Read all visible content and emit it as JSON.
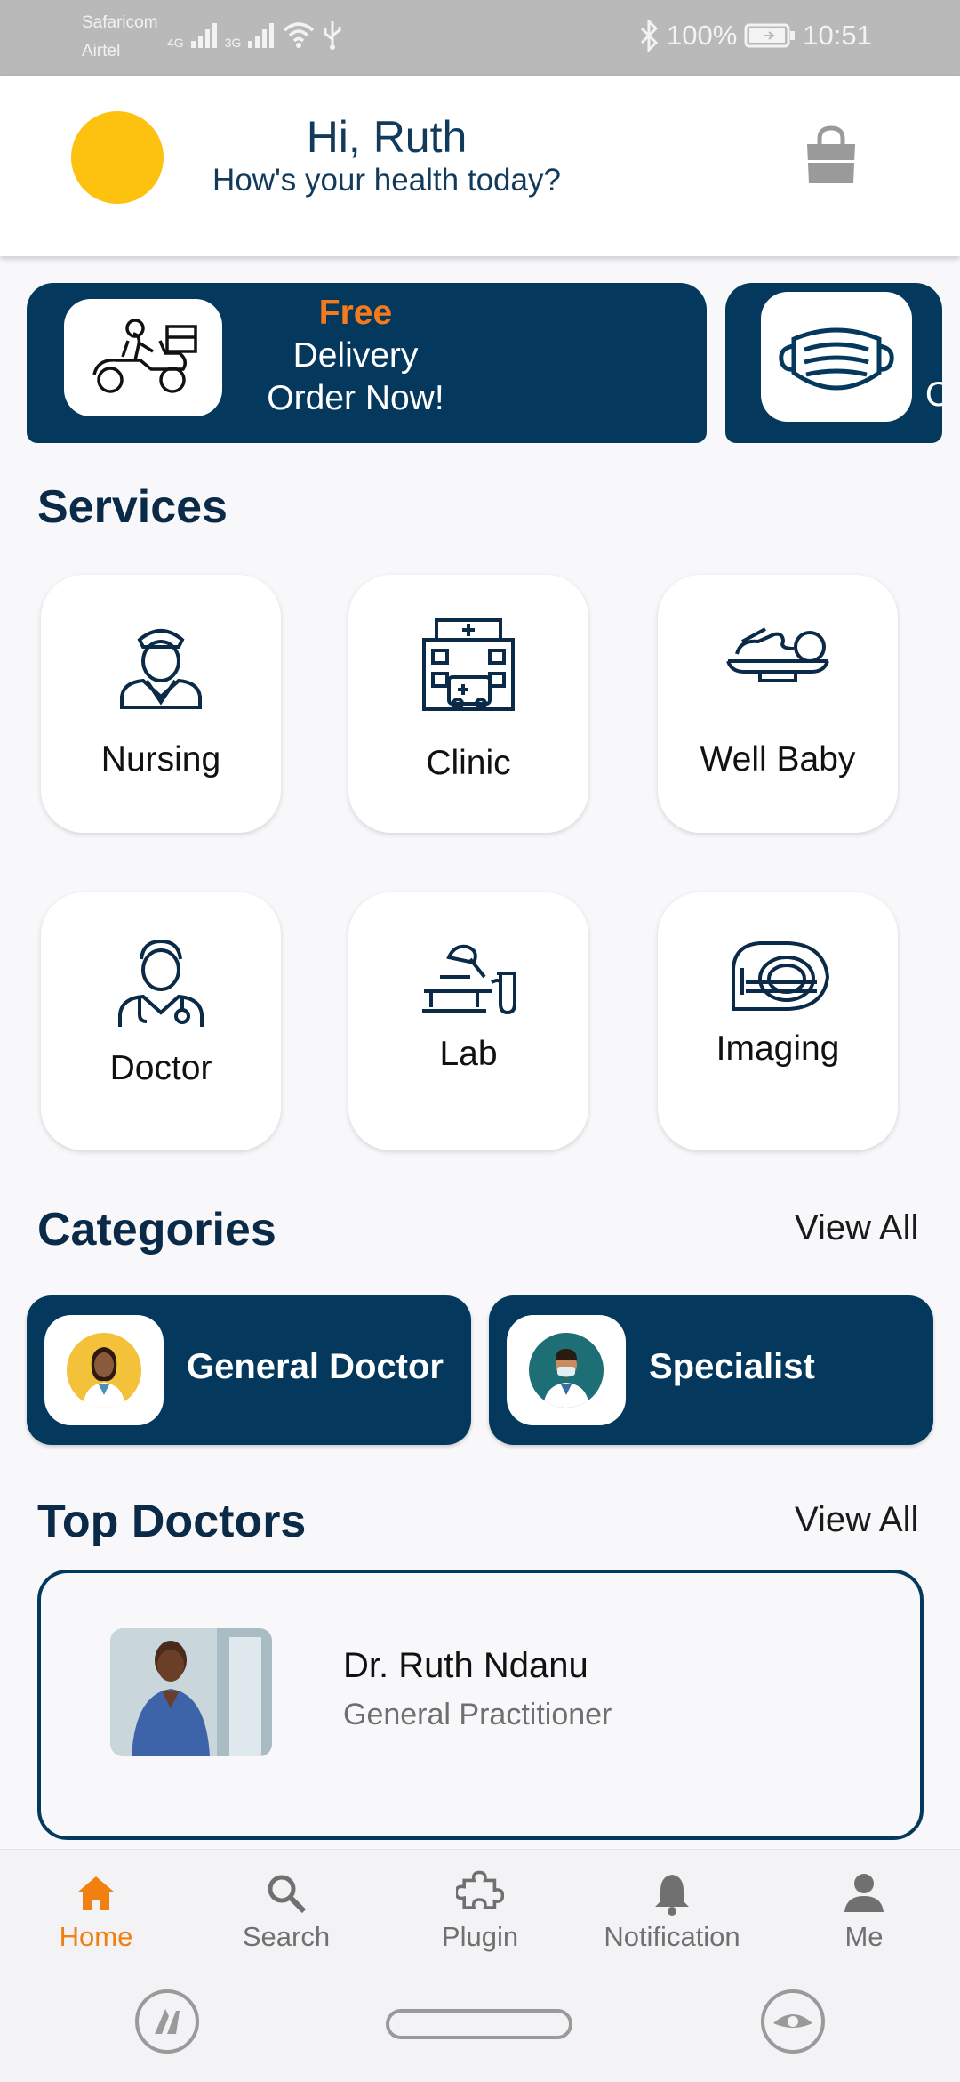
{
  "status_bar": {
    "carrier_1": "Safaricom",
    "carrier_2": "Airtel",
    "network_1": "4G",
    "network_2": "3G",
    "battery": "100%",
    "time": "10:51"
  },
  "header": {
    "greeting": "Hi, Ruth",
    "subtitle": "How's your health today?",
    "avatar_color": "#fdc110"
  },
  "banners": [
    {
      "accent": "Free",
      "line1": "Delivery",
      "line2": "Order Now!",
      "icon": "delivery-scooter-icon"
    },
    {
      "line1": "",
      "line2": "C",
      "icon": "face-mask-icon"
    }
  ],
  "services": {
    "title": "Services",
    "items": [
      {
        "label": "Nursing",
        "icon": "nurse-icon"
      },
      {
        "label": "Clinic",
        "icon": "hospital-icon"
      },
      {
        "label": "Well Baby",
        "icon": "baby-scale-icon"
      },
      {
        "label": "Doctor",
        "icon": "doctor-icon"
      },
      {
        "label": "Lab",
        "icon": "microscope-icon"
      },
      {
        "label": "Imaging",
        "icon": "mri-scanner-icon"
      }
    ]
  },
  "categories": {
    "title": "Categories",
    "view_all": "View All",
    "items": [
      {
        "label": "General Doctor",
        "avatar_bg": "#f4c23a"
      },
      {
        "label": "Specialist",
        "avatar_bg": "#1e6f75"
      }
    ]
  },
  "top_doctors": {
    "title": "Top Doctors",
    "view_all": "View All",
    "doctors": [
      {
        "name": "Dr. Ruth Ndanu",
        "specialty": "General Practitioner"
      }
    ]
  },
  "bottom_nav": {
    "items": [
      {
        "label": "Home",
        "icon": "home-icon",
        "active": true
      },
      {
        "label": "Search",
        "icon": "search-icon",
        "active": false
      },
      {
        "label": "Plugin",
        "icon": "plugin-icon",
        "active": false
      },
      {
        "label": "Notification",
        "icon": "bell-icon",
        "active": false
      },
      {
        "label": "Me",
        "icon": "person-icon",
        "active": false
      }
    ]
  },
  "colors": {
    "primary": "#04385c",
    "accent": "#f27f12",
    "background": "#f8f8fa"
  }
}
